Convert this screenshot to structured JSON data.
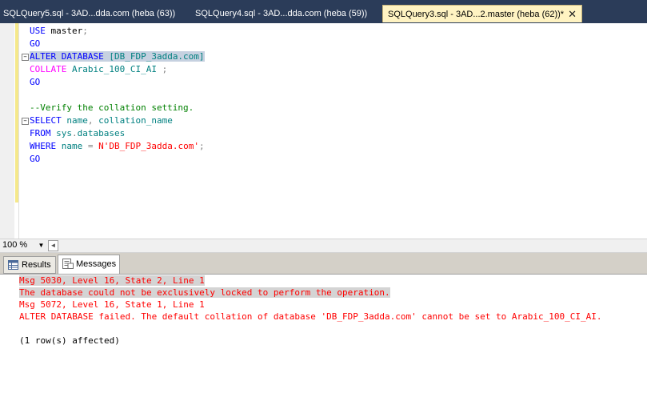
{
  "tabs": [
    {
      "label": "SQLQuery5.sql - 3AD...dda.com (heba (63))",
      "active": false
    },
    {
      "label": "SQLQuery4.sql - 3AD...dda.com (heba (59))",
      "active": false
    },
    {
      "label": "SQLQuery3.sql - 3AD...2.master (heba (62))*",
      "active": true,
      "close_glyph": "✕"
    }
  ],
  "editor": {
    "lines": [
      {
        "parts": [
          {
            "text": "USE",
            "cls": "kw"
          },
          {
            "text": " master",
            "cls": "id"
          },
          {
            "text": ";",
            "cls": "gr"
          }
        ]
      },
      {
        "parts": [
          {
            "text": "GO",
            "cls": "kw"
          }
        ]
      },
      {
        "parts": [
          {
            "text": "ALTER DATABASE",
            "cls": "kw"
          },
          {
            "text": " ",
            "cls": "id"
          },
          {
            "text": "[DB_FDP_3adda.com]",
            "cls": "obj"
          }
        ],
        "selected": true,
        "collapse": "−"
      },
      {
        "parts": [
          {
            "text": "COLLATE",
            "cls": "fn"
          },
          {
            "text": " Arabic_100_CI_AI ",
            "cls": "obj"
          },
          {
            "text": ";",
            "cls": "gr"
          }
        ]
      },
      {
        "parts": [
          {
            "text": "GO",
            "cls": "kw"
          }
        ]
      },
      {
        "parts": []
      },
      {
        "parts": [
          {
            "text": "--Verify the collation setting.",
            "cls": "cm"
          }
        ]
      },
      {
        "parts": [
          {
            "text": "SELECT",
            "cls": "kw"
          },
          {
            "text": " name",
            "cls": "obj"
          },
          {
            "text": ",",
            "cls": "gr"
          },
          {
            "text": " collation_name",
            "cls": "obj"
          }
        ],
        "collapse": "−"
      },
      {
        "parts": [
          {
            "text": "FROM",
            "cls": "kw"
          },
          {
            "text": " sys",
            "cls": "obj"
          },
          {
            "text": ".",
            "cls": "gr"
          },
          {
            "text": "databases",
            "cls": "obj"
          }
        ]
      },
      {
        "parts": [
          {
            "text": "WHERE",
            "cls": "kw"
          },
          {
            "text": " name ",
            "cls": "obj"
          },
          {
            "text": "=",
            "cls": "gr"
          },
          {
            "text": " N'DB_FDP_3adda.com'",
            "cls": "str"
          },
          {
            "text": ";",
            "cls": "gr"
          }
        ]
      },
      {
        "parts": [
          {
            "text": "GO",
            "cls": "kw"
          }
        ]
      }
    ]
  },
  "zoom": {
    "value": "100 %",
    "drop_glyph": "▼",
    "scroll_left_glyph": "◄"
  },
  "results_tabs": [
    {
      "label": "Results",
      "active": false
    },
    {
      "label": "Messages",
      "active": true
    }
  ],
  "messages": [
    {
      "text": "Msg 5030, Level 16, State 2, Line 1",
      "type": "err",
      "selected": true
    },
    {
      "text": "The database could not be exclusively locked to perform the operation.",
      "type": "err",
      "selected": true
    },
    {
      "text": "Msg 5072, Level 16, State 1, Line 1",
      "type": "err",
      "selected": false
    },
    {
      "text": "ALTER DATABASE failed. The default collation of database 'DB_FDP_3adda.com' cannot be set to Arabic_100_CI_AI.",
      "type": "err",
      "selected": false
    },
    {
      "text": "",
      "type": "ok",
      "selected": false
    },
    {
      "text": "(1 row(s) affected)",
      "type": "ok",
      "selected": false
    }
  ],
  "colors": {
    "tab_strip": "#2b3c59",
    "active_tab": "#fff3c2",
    "keyword": "#0000ff",
    "error": "#ff0000",
    "comment": "#008000"
  }
}
